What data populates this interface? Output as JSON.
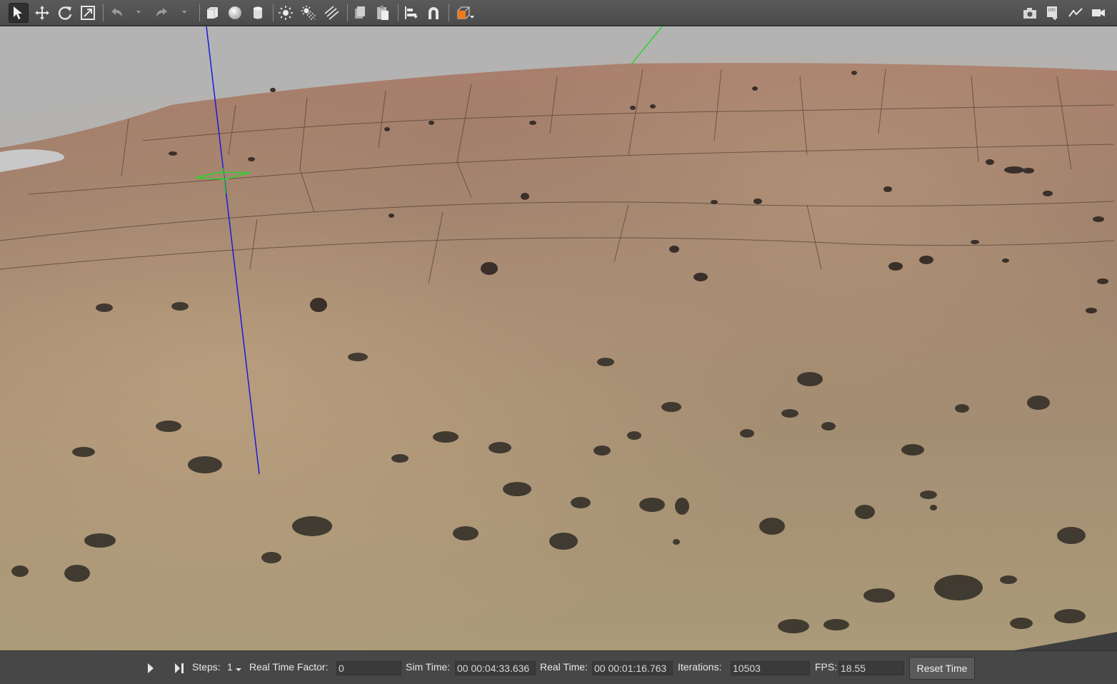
{
  "toolbar": {
    "left_tools": [
      {
        "name": "select-mode",
        "icon": "arrow-cursor-icon",
        "active": true
      },
      {
        "name": "translate-mode",
        "icon": "move-arrows-icon"
      },
      {
        "name": "rotate-mode",
        "icon": "rotate-icon"
      },
      {
        "name": "scale-mode",
        "icon": "scale-icon"
      },
      {
        "name": "undo",
        "icon": "undo-icon"
      },
      {
        "name": "redo",
        "icon": "redo-icon"
      },
      {
        "name": "box-shape",
        "icon": "box-icon"
      },
      {
        "name": "sphere-shape",
        "icon": "sphere-icon"
      },
      {
        "name": "cylinder-shape",
        "icon": "cylinder-icon"
      },
      {
        "name": "point-light",
        "icon": "point-light-icon"
      },
      {
        "name": "spot-light",
        "icon": "spot-light-icon"
      },
      {
        "name": "directional-light",
        "icon": "directional-light-icon"
      },
      {
        "name": "copy",
        "icon": "copy-icon"
      },
      {
        "name": "paste",
        "icon": "paste-icon"
      },
      {
        "name": "align",
        "icon": "align-icon"
      },
      {
        "name": "snap",
        "icon": "magnet-icon"
      },
      {
        "name": "view-angle",
        "icon": "view-cube-icon"
      }
    ],
    "right_tools": [
      {
        "name": "screenshot",
        "icon": "camera-icon"
      },
      {
        "name": "log",
        "icon": "log-icon",
        "text": "LOG"
      },
      {
        "name": "plot",
        "icon": "plot-icon"
      },
      {
        "name": "record-video",
        "icon": "video-icon"
      }
    ],
    "accent_color": "#f07a1a"
  },
  "viewport": {
    "sky_color": "#b3b3b3",
    "terrain_color": "#a8906f",
    "axis_colors": {
      "z": "#1a1adc",
      "y": "#29d629",
      "origin_marker": "#29d629"
    }
  },
  "bottom_bar": {
    "play_icon": "play-icon",
    "step_icon": "step-icon",
    "steps_label": "Steps:",
    "steps_value": "1",
    "rtf_label": "Real Time Factor:",
    "rtf_value": "0",
    "sim_time_label": "Sim Time:",
    "sim_time_value": "00 00:04:33.636",
    "real_time_label": "Real Time:",
    "real_time_value": "00 00:01:16.763",
    "iterations_label": "Iterations:",
    "iterations_value": "10503",
    "fps_label": "FPS:",
    "fps_value": "18.55",
    "reset_label": "Reset Time"
  }
}
